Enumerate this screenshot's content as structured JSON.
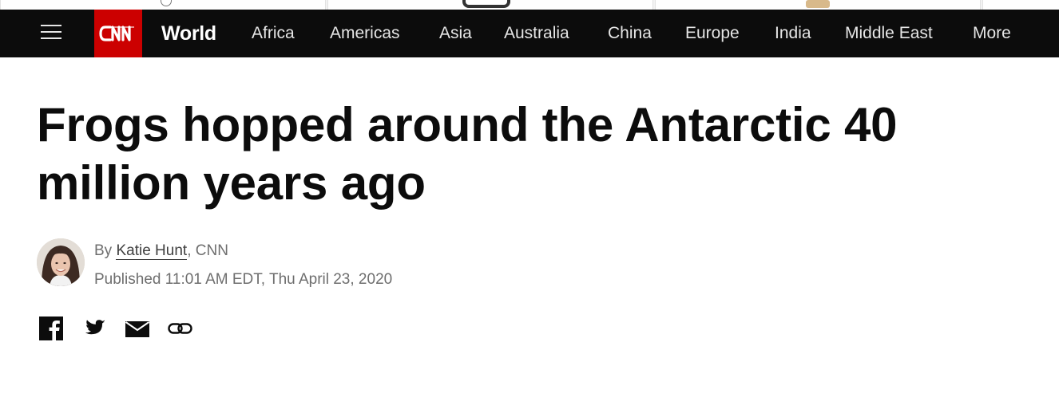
{
  "nav": {
    "menu_icon": "hamburger-menu-icon",
    "logo_text": "CNN",
    "section": "World",
    "links": [
      "Africa",
      "Americas",
      "Asia",
      "Australia",
      "China",
      "Europe",
      "India",
      "Middle East",
      "More"
    ]
  },
  "article": {
    "headline": "Frogs hopped around the Antarctic 40 million years ago",
    "byline_prefix": "By ",
    "author": "Katie Hunt",
    "byline_suffix": ", CNN",
    "published": "Published 11:01 AM EDT, Thu April 23, 2020"
  },
  "share": {
    "icons": [
      "facebook-icon",
      "twitter-icon",
      "email-icon",
      "link-icon"
    ]
  },
  "colors": {
    "brand_red": "#cc0000",
    "nav_background": "#0c0c0c",
    "headline_text": "#0c0c0c",
    "meta_text": "#6e6e6e"
  }
}
